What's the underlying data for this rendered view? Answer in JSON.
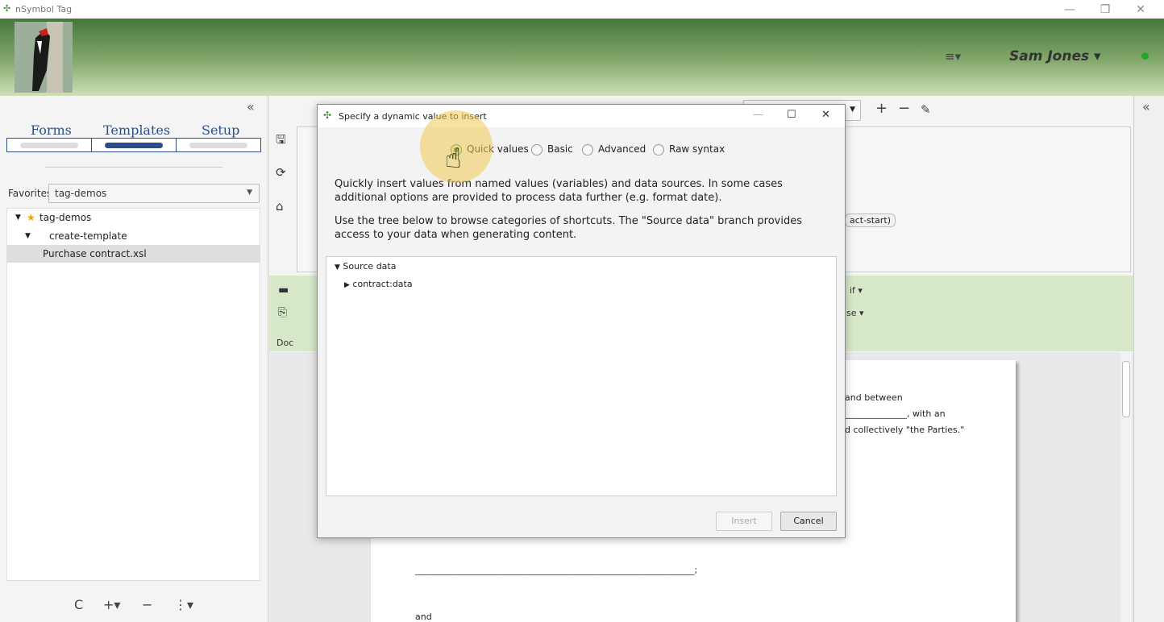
{
  "window": {
    "title": "nSymbol Tag"
  },
  "header": {
    "user_name": "Sam Jones ▾",
    "menu_icon": "≡▾"
  },
  "left": {
    "collapse": "«",
    "tabs": [
      {
        "label": "Forms"
      },
      {
        "label": "Templates"
      },
      {
        "label": "Setup"
      }
    ],
    "favorites_label": "Favorites",
    "favorites_value": "tag-demos",
    "tree": [
      {
        "label": "tag-demos",
        "toggle": "▼"
      },
      {
        "label": "create-template",
        "toggle": "▼"
      },
      {
        "label": "Purchase contract.xsl",
        "toggle": ""
      }
    ],
    "toolbar": {
      "refresh": "C",
      "add": "+▾",
      "remove": "−",
      "more": "⋮▾"
    }
  },
  "editor": {
    "chip_text": "act-start)",
    "green_bar": {
      "doc_label": "Doc",
      "if_label": "if ▾",
      "else_label": "se ▾"
    },
    "doc_lines": [
      "and between",
      "______________, with an",
      "d collectively \"the Parties.\"",
      "_______________________________________________________________;",
      "and"
    ],
    "collapse_right": "«"
  },
  "dialog": {
    "title": "Specify a dynamic value to insert",
    "modes": [
      {
        "label": "Quick values",
        "checked": true
      },
      {
        "label": "Basic",
        "checked": false
      },
      {
        "label": "Advanced",
        "checked": false
      },
      {
        "label": "Raw syntax",
        "checked": false
      }
    ],
    "para1": "Quickly insert values from named values (variables) and data sources. In some cases additional options are provided to process data further (e.g. format date).",
    "para2": "Use the tree below to browse categories of shortcuts. The \"Source data\" branch provides access to your data when generating content.",
    "tree": [
      {
        "label": "Source data",
        "toggle": "▼"
      },
      {
        "label": "contract:data",
        "toggle": "▶"
      }
    ],
    "insert_label": "Insert",
    "cancel_label": "Cancel"
  },
  "colors": {
    "accent": "#2a4f88",
    "header_green": "#45763c",
    "status": "#23a82e"
  }
}
